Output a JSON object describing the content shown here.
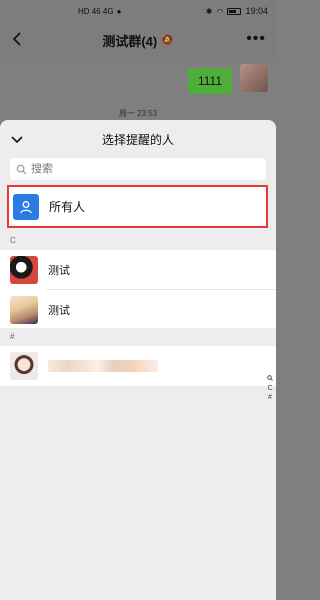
{
  "status_bar": {
    "network": "HD 46 4G",
    "time": "19:04"
  },
  "chat": {
    "title": "测试群(4)",
    "message": "1111",
    "timestamp": "周一 23:53"
  },
  "sheet": {
    "title": "选择提醒的人",
    "search_placeholder": "搜索",
    "all_label": "所有人",
    "sections": [
      {
        "letter": "C",
        "contacts": [
          {
            "name": "测试"
          },
          {
            "name": "测试"
          }
        ]
      },
      {
        "letter": "#",
        "contacts": [
          {
            "name": ""
          }
        ]
      }
    ],
    "index": [
      "Q",
      "C",
      "#"
    ]
  },
  "colors": {
    "highlight_border": "#e53935",
    "all_icon_bg": "#2b7be4",
    "bubble": "#4fae3a"
  }
}
